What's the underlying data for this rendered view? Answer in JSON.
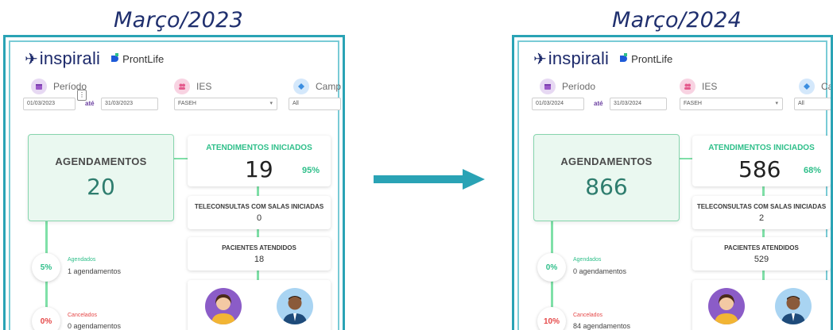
{
  "captions": {
    "left": "Março/2023",
    "right": "Março/2024"
  },
  "brand": {
    "name": "inspirali",
    "partner": "ProntLife"
  },
  "filters": {
    "periodo_label": "Período",
    "ies_label": "IES",
    "ate_label": "até"
  },
  "colors": {
    "frame": "#2aa3b5",
    "accent_green": "#2fbf8a",
    "agendamentos_box": "#eaf8f0",
    "arrow": "#2aa3b5"
  },
  "left": {
    "campus_label": "Camp",
    "date_start": "01/03/2023",
    "date_end": "31/03/2023",
    "ies_value": "FASEH",
    "campus_value": "All",
    "agendamentos_title": "AGENDAMENTOS",
    "agendamentos_value": "20",
    "atend_title": "ATENDIMENTOS INICIADOS",
    "atend_value": "19",
    "atend_pct": "95%",
    "tele_title": "TELECONSULTAS COM SALAS INICIADAS",
    "tele_value": "0",
    "pac_title": "PACIENTES ATENDIDOS",
    "pac_value": "18",
    "agendados_pct": "5%",
    "agendados_label": "Agendados",
    "agendados_sub": "1 agendamentos",
    "cancelados_pct": "0%",
    "cancelados_label": "Cancelados",
    "cancelados_sub": "0 agendamentos"
  },
  "right": {
    "campus_label": "Ca",
    "date_start": "01/03/2024",
    "date_end": "31/03/2024",
    "ies_value": "FASEH",
    "campus_value": "All",
    "agendamentos_title": "AGENDAMENTOS",
    "agendamentos_value": "866",
    "atend_title": "ATENDIMENTOS INICIADOS",
    "atend_value": "586",
    "atend_pct": "68%",
    "tele_title": "TELECONSULTAS COM SALAS INICIADAS",
    "tele_value": "2",
    "pac_title": "PACIENTES ATENDIDOS",
    "pac_value": "529",
    "agendados_pct": "0%",
    "agendados_label": "Agendados",
    "agendados_sub": "0 agendamentos",
    "cancelados_pct": "10%",
    "cancelados_label": "Cancelados",
    "cancelados_sub": "84 agendamentos"
  }
}
